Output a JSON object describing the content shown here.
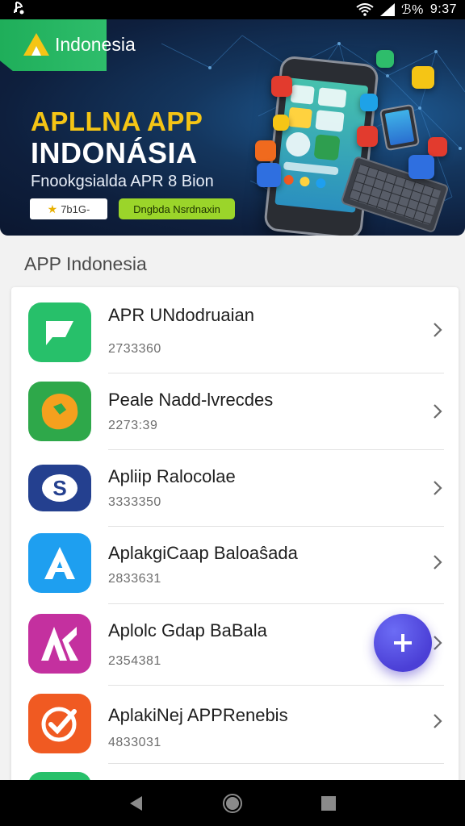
{
  "status_bar": {
    "left_icon": "app-notification-icon",
    "battery": "ℬ%",
    "time": "9:37",
    "icons": [
      "wifi-icon",
      "signal-icon"
    ]
  },
  "banner": {
    "brand": "Indonesia",
    "title_line1": "APLLNA APP",
    "title_line2": "INDONÁSIA",
    "subtitle": "Fnookgsialda APR 8 Bion",
    "button1_label": "7b1G-",
    "button2_label": "Dngbda Nsrdnaxin",
    "active_slide": 1,
    "slide_count": 2,
    "colors": {
      "brand_green": "#2ebd6b",
      "title_yellow": "#f5c515",
      "cta_green": "#9bd52a"
    }
  },
  "section": {
    "title": "APP Indonesia"
  },
  "apps": [
    {
      "name": "APR UNdodruaian",
      "sub": "2733360",
      "icon": "chat-bubble-icon",
      "color": "#27c06a"
    },
    {
      "name": "Peale Nadd-lvrecdes",
      "sub": "2273:39",
      "icon": "orange-blob-icon",
      "color": "#2ea84a"
    },
    {
      "name": "Apliip Ralocolae",
      "sub": "3333350",
      "icon": "s-badge-icon",
      "color": "#24408f"
    },
    {
      "name": "AplakgiCaap Baloaŝada",
      "sub": "2833631",
      "icon": "letter-a-icon",
      "color": "#1e9ff0"
    },
    {
      "name": "Aplolc Gdap BaBala",
      "sub": "2354381",
      "icon": "letter-ak-icon",
      "color": "#c4309f"
    },
    {
      "name": "AplakiNej APPRenebis",
      "sub": "4833031",
      "icon": "check-circle-icon",
      "color": "#f05a22"
    }
  ],
  "fab": {
    "label": "+",
    "color": "#5a4fe6"
  },
  "nav": {
    "buttons": [
      "back-icon",
      "home-icon",
      "recents-icon"
    ]
  }
}
